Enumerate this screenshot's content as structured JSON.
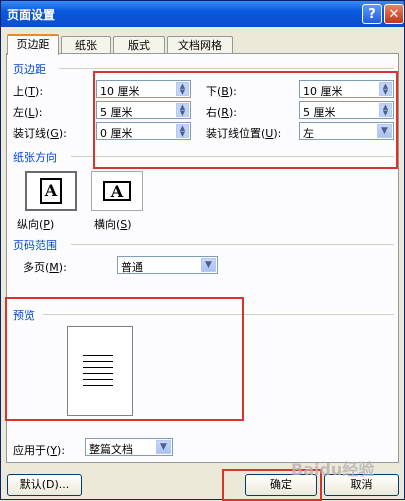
{
  "window": {
    "title": "页面设置",
    "help_label": "?",
    "close_label": "✕"
  },
  "tabs": [
    {
      "label": "页边距",
      "active": true
    },
    {
      "label": "纸张",
      "active": false
    },
    {
      "label": "版式",
      "active": false
    },
    {
      "label": "文档网格",
      "active": false
    }
  ],
  "margins": {
    "group_title": "页边距",
    "top": {
      "label": "上",
      "key": "T",
      "value": "10 厘米"
    },
    "bottom": {
      "label": "下",
      "key": "B",
      "value": "10 厘米"
    },
    "left": {
      "label": "左",
      "key": "L",
      "value": "5 厘米"
    },
    "right": {
      "label": "右",
      "key": "R",
      "value": "5 厘米"
    },
    "gutter": {
      "label": "装订线",
      "key": "G",
      "value": "0 厘米"
    },
    "gutter_pos": {
      "label": "装订线位置",
      "key": "U",
      "value": "左"
    }
  },
  "orientation": {
    "group_title": "纸张方向",
    "portrait": {
      "label": "纵向",
      "key": "P",
      "glyph": "A"
    },
    "landscape": {
      "label": "横向",
      "key": "S",
      "glyph": "A"
    }
  },
  "pages": {
    "group_title": "页码范围",
    "multiple": {
      "label": "多页",
      "key": "M",
      "value": "普通"
    }
  },
  "preview": {
    "group_title": "预览"
  },
  "apply": {
    "label": "应用于",
    "key": "Y",
    "value": "整篇文档"
  },
  "buttons": {
    "default": "默认(D)...",
    "ok": "确定",
    "cancel": "取消"
  },
  "watermark": "Baidu经验"
}
